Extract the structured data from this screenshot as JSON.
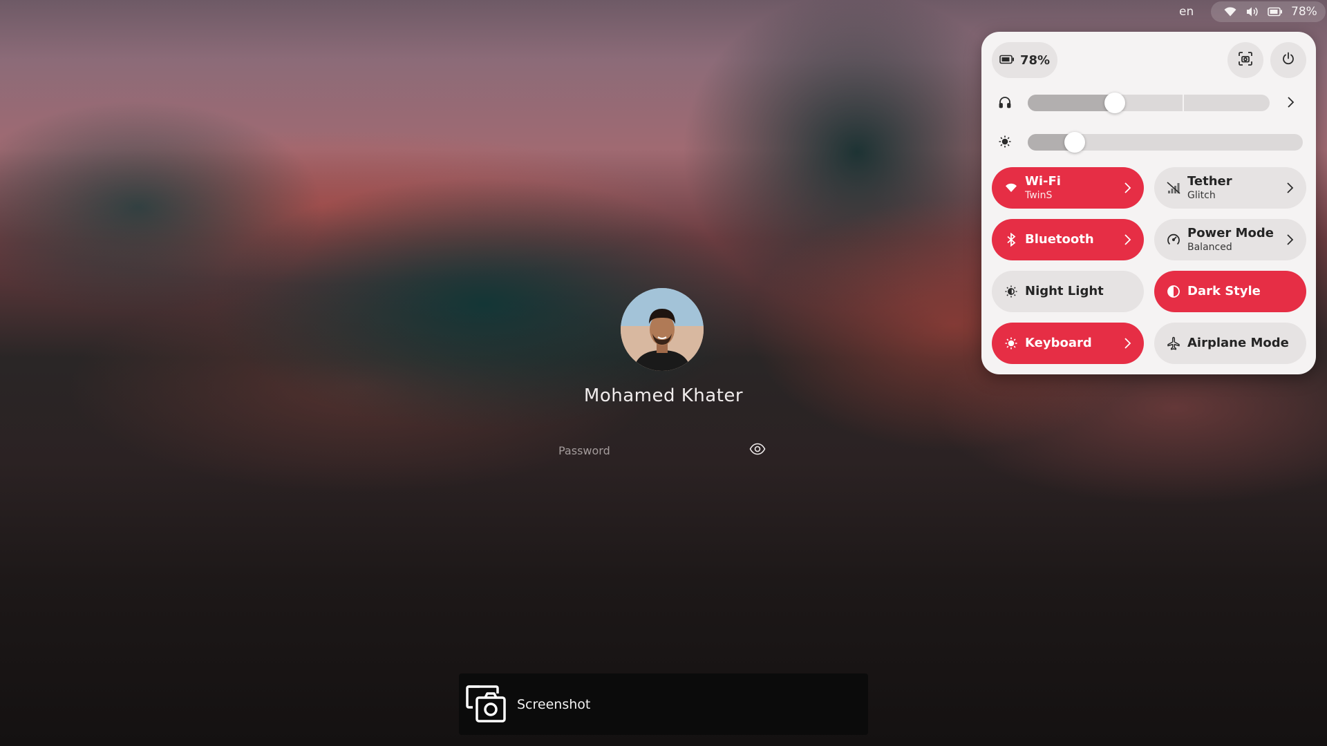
{
  "top_bar": {
    "language": "en",
    "battery_percent": "78%",
    "icons": [
      "wifi-icon",
      "volume-icon",
      "battery-icon"
    ]
  },
  "quick_settings": {
    "battery_label": "78%",
    "output_volume_level": 0.36,
    "brightness_level": 0.17,
    "accent_color": "#e62e45",
    "tiles": {
      "wifi": {
        "title": "Wi-Fi",
        "subtitle": "TwinS",
        "active": true
      },
      "tether": {
        "title": "Tether",
        "subtitle": "Glitch",
        "active": false
      },
      "bluetooth": {
        "title": "Bluetooth",
        "active": true
      },
      "power_mode": {
        "title": "Power Mode",
        "subtitle": "Balanced",
        "active": false
      },
      "night_light": {
        "title": "Night Light",
        "active": false
      },
      "dark_style": {
        "title": "Dark Style",
        "active": true
      },
      "keyboard": {
        "title": "Keyboard",
        "active": true
      },
      "airplane_mode": {
        "title": "Airplane Mode",
        "active": false
      }
    }
  },
  "login": {
    "user_name": "Mohamed Khater",
    "password_placeholder": "Password"
  },
  "osd": {
    "label": "Screenshot"
  }
}
